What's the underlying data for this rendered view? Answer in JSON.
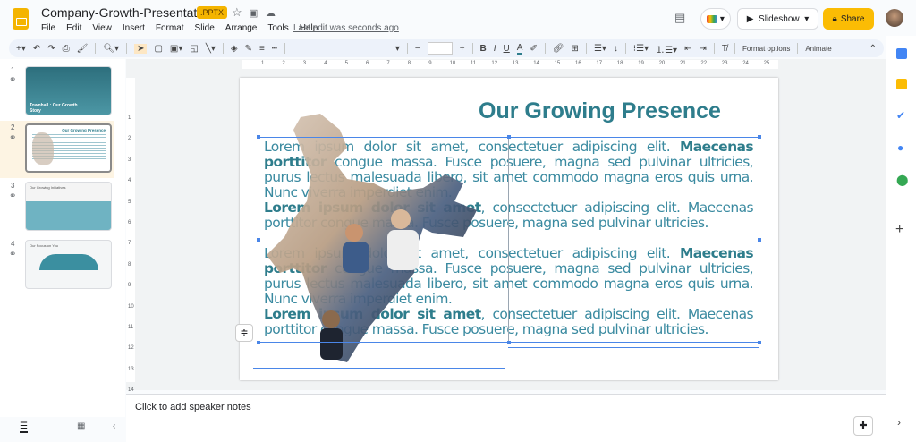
{
  "app": {
    "title": "Company-Growth-Presentation",
    "badge": ".PPTX",
    "last_edit": "Last edit was seconds ago",
    "menu": [
      "File",
      "Edit",
      "View",
      "Insert",
      "Format",
      "Slide",
      "Arrange",
      "Tools",
      "Help"
    ],
    "slideshow_label": "Slideshow",
    "share_label": "Share"
  },
  "toolbar": {
    "format_options": "Format options",
    "animate": "Animate"
  },
  "filmstrip": [
    {
      "num": "1",
      "title": "Townhall : Our Growth Story"
    },
    {
      "num": "2",
      "title": "Our Growing Presence"
    },
    {
      "num": "3",
      "title": "Our Growing Initiatives"
    },
    {
      "num": "4",
      "title": "Our Focus on You"
    }
  ],
  "slide": {
    "title": "Our Growing Presence",
    "p1_bold": "Maecenas porttitor",
    "p1_a": "Lorem ipsum dolor sit amet, consectetuer adipiscing elit. ",
    "p1_b": " congue massa. Fusce posuere, magna sed pulvinar ultricies, purus lectus malesuada libero, sit amet commodo magna eros quis urna. Nunc viverra imperdiet enim.",
    "p2_bold": "Lorem ipsum dolor sit amet",
    "p2_rest": ", consectetuer adipiscing elit. Maecenas porttitor congue massa. Fusce posuere, magna sed pulvinar ultricies."
  },
  "hruler": [
    "1",
    "2",
    "3",
    "4",
    "5",
    "6",
    "7",
    "8",
    "9",
    "10",
    "11",
    "12",
    "13",
    "14",
    "15",
    "16",
    "17",
    "18",
    "19",
    "20",
    "21",
    "22",
    "23",
    "24",
    "25"
  ],
  "vruler": [
    "1",
    "2",
    "3",
    "4",
    "5",
    "6",
    "7",
    "8",
    "9",
    "10",
    "11",
    "12",
    "13",
    "14"
  ],
  "notes": {
    "placeholder": "Click to add speaker notes"
  },
  "colors": {
    "accent": "#2e7d8c",
    "share": "#fbbc04",
    "selection": "#4a86e8"
  }
}
